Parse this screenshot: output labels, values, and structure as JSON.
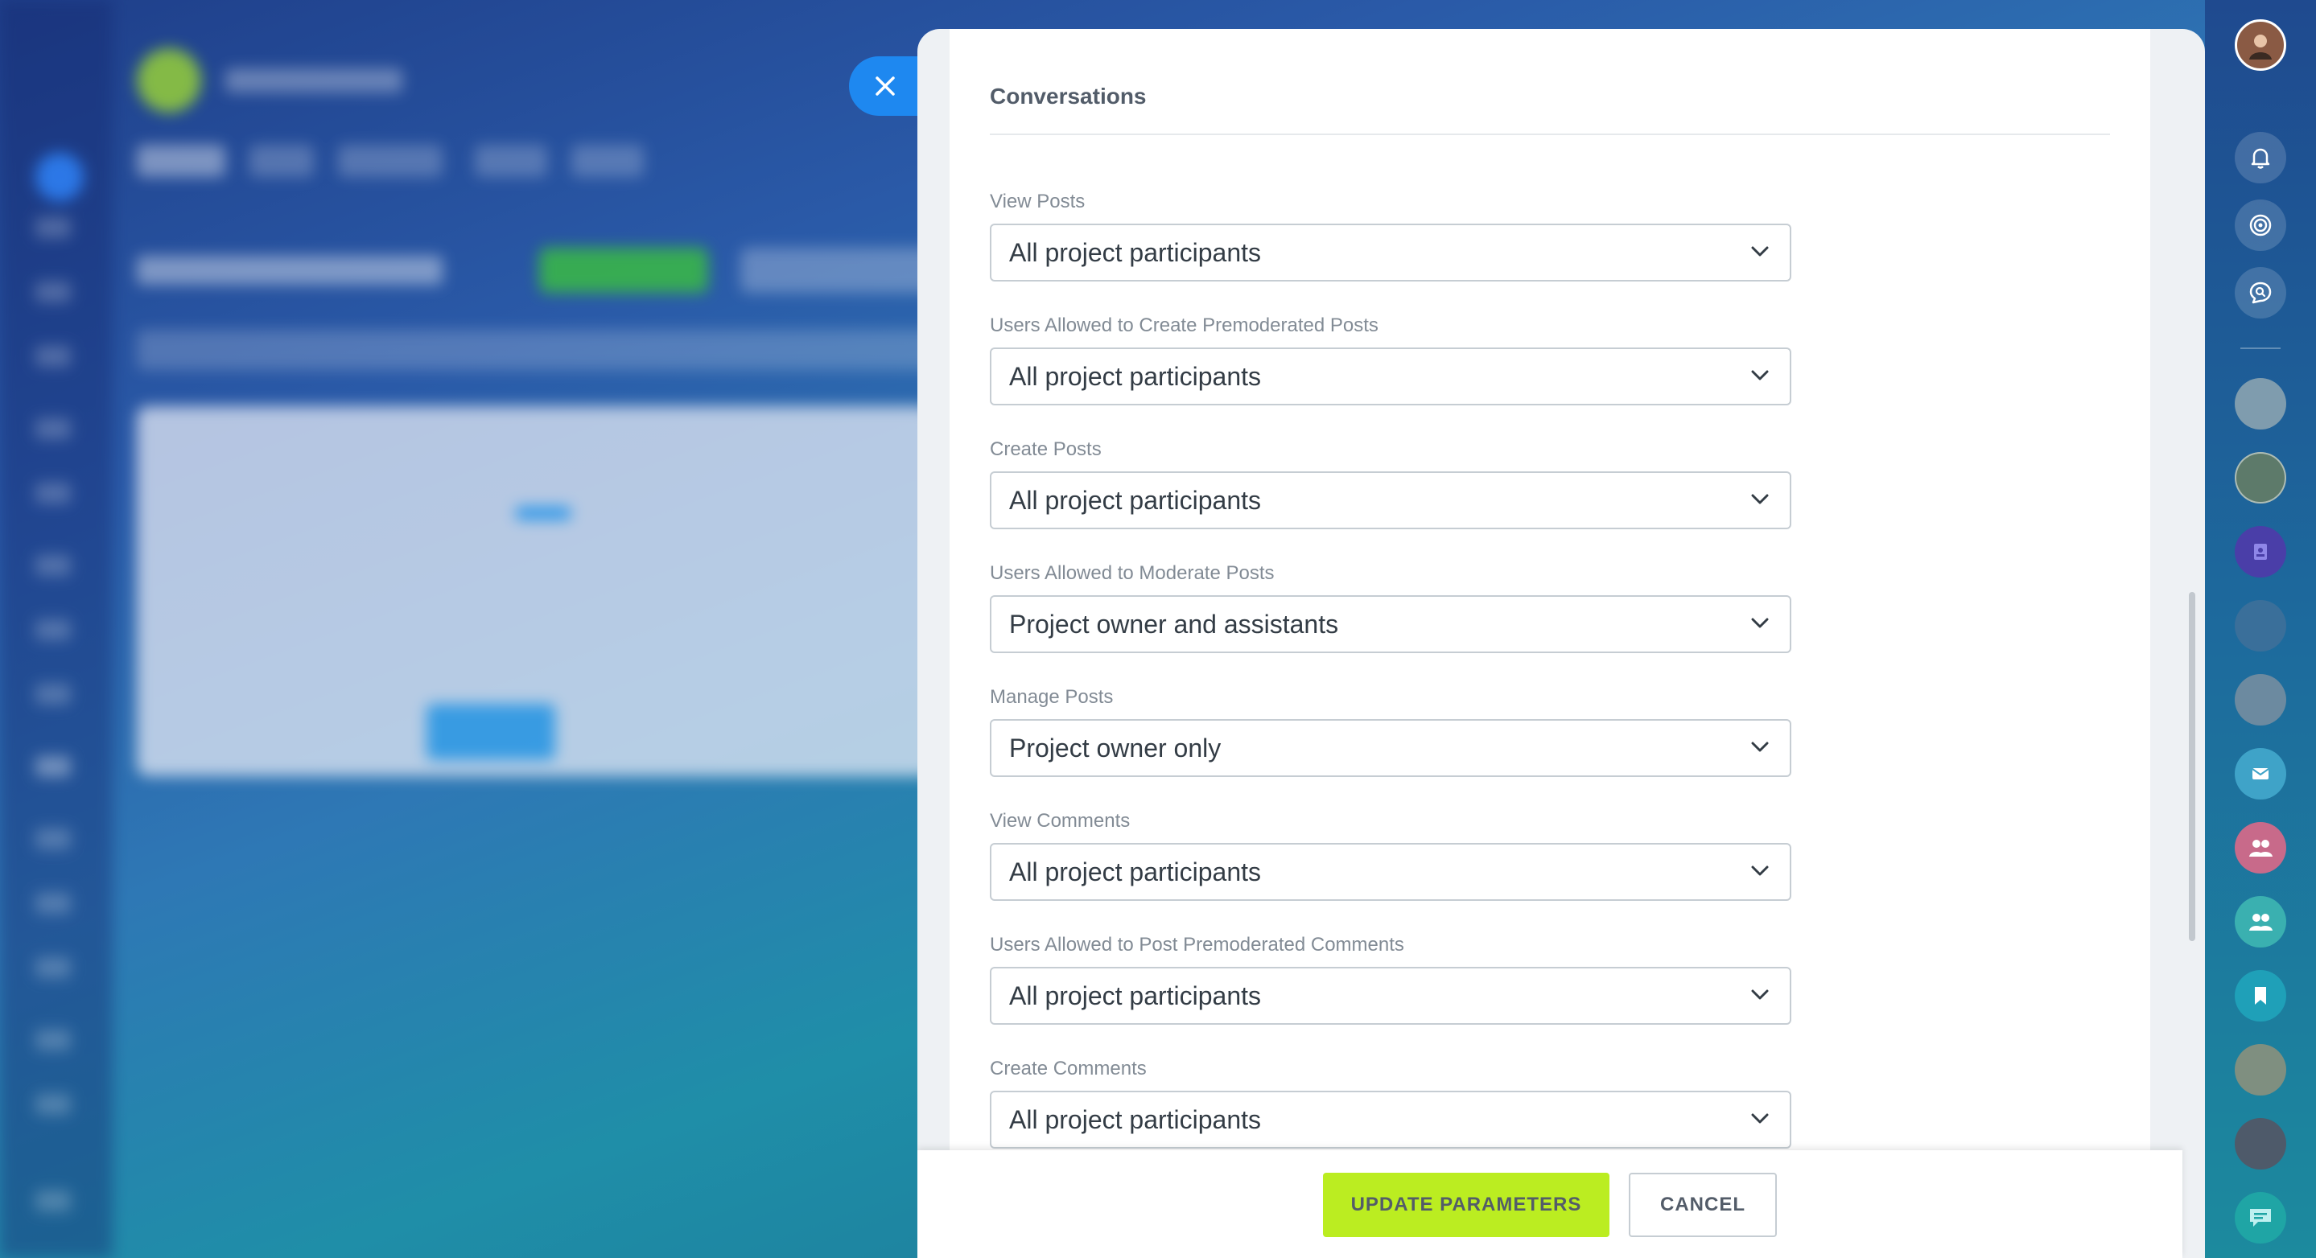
{
  "dialog": {
    "section_title": "Conversations",
    "fields": [
      {
        "label": "View Posts",
        "value": "All project participants"
      },
      {
        "label": "Users Allowed to Create Premoderated Posts",
        "value": "All project participants"
      },
      {
        "label": "Create Posts",
        "value": "All project participants"
      },
      {
        "label": "Users Allowed to Moderate Posts",
        "value": "Project owner and assistants"
      },
      {
        "label": "Manage Posts",
        "value": "Project owner only"
      },
      {
        "label": "View Comments",
        "value": "All project participants"
      },
      {
        "label": "Users Allowed to Post Premoderated Comments",
        "value": "All project participants"
      },
      {
        "label": "Create Comments",
        "value": "All project participants"
      }
    ],
    "buttons": {
      "update": "UPDATE PARAMETERS",
      "cancel": "CANCEL"
    }
  },
  "colors": {
    "accent_blue": "#1e88f0",
    "update_button": "#bbed21",
    "label": "#828b95",
    "value": "#333c45"
  },
  "right_bar": {
    "items": [
      "user-avatar",
      "bell-icon",
      "target-icon",
      "search-chat-icon",
      "contact-avatar",
      "contact-avatar",
      "address-book-icon",
      "contact-avatar",
      "group-avatar",
      "mail-icon",
      "group-icon",
      "group-icon",
      "bookmark-icon",
      "contact-avatar",
      "contact-avatar",
      "chat-icon"
    ]
  }
}
